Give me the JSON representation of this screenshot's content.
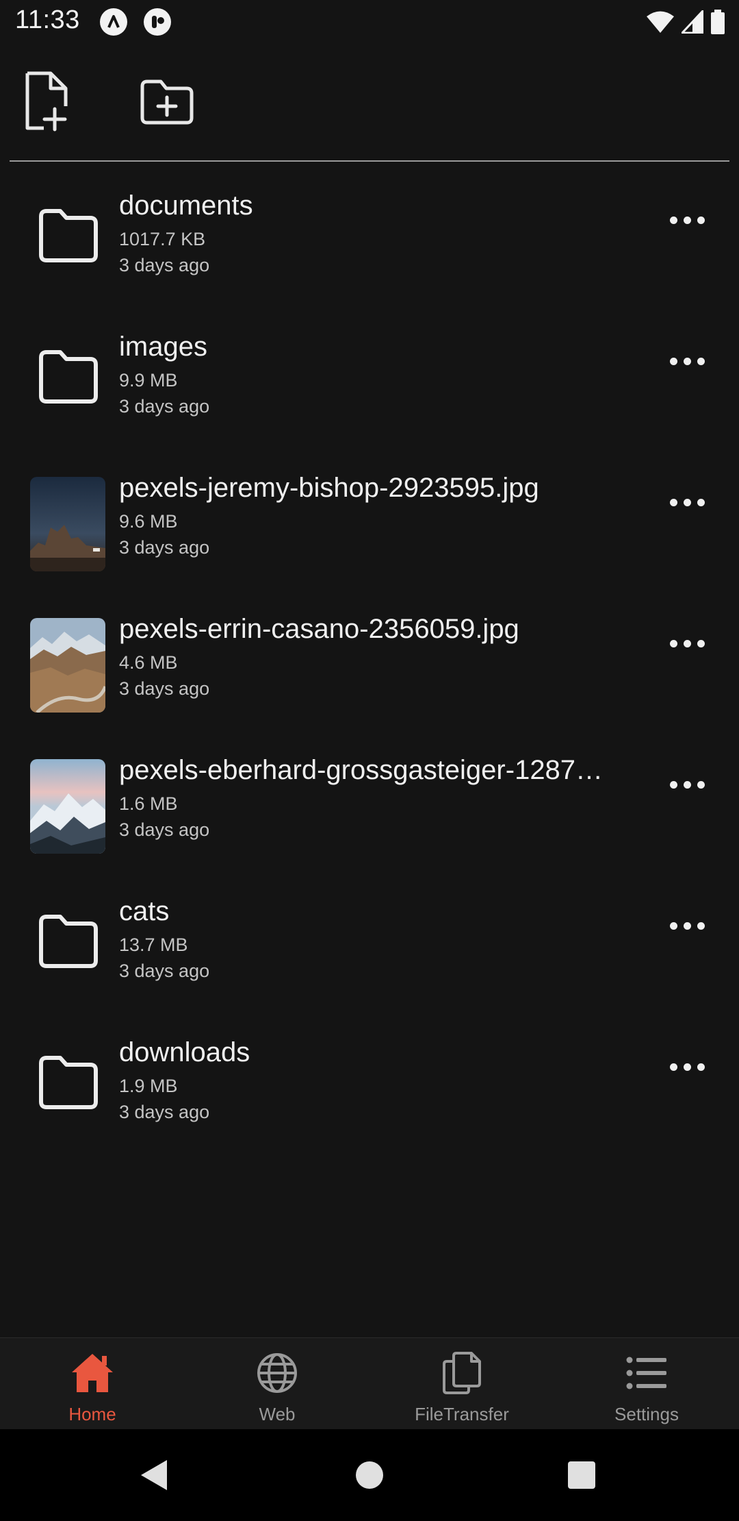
{
  "status_bar": {
    "time": "11:33",
    "icons": [
      "app-notification-icon",
      "app-notification-icon-2",
      "wifi-icon",
      "cellular-signal-icon",
      "battery-icon"
    ]
  },
  "toolbar": {
    "new_file_icon": "file-plus-icon",
    "new_folder_icon": "folder-plus-icon"
  },
  "files": [
    {
      "type": "folder",
      "name": "documents",
      "size": "1017.7 KB",
      "date": "3 days ago"
    },
    {
      "type": "folder",
      "name": "images",
      "size": "9.9 MB",
      "date": "3 days ago"
    },
    {
      "type": "image",
      "name": "pexels-jeremy-bishop-2923595.jpg",
      "size": "9.6 MB",
      "date": "3 days ago"
    },
    {
      "type": "image",
      "name": "pexels-errin-casano-2356059.jpg",
      "size": "4.6 MB",
      "date": "3 days ago"
    },
    {
      "type": "image",
      "name": "pexels-eberhard-grossgasteiger-1287…",
      "size": "1.6 MB",
      "date": "3 days ago"
    },
    {
      "type": "folder",
      "name": "cats",
      "size": "13.7 MB",
      "date": "3 days ago"
    },
    {
      "type": "folder",
      "name": "downloads",
      "size": "1.9 MB",
      "date": "3 days ago"
    }
  ],
  "bottom_nav": {
    "items": [
      {
        "label": "Home",
        "icon": "home-icon",
        "active": true
      },
      {
        "label": "Web",
        "icon": "globe-icon",
        "active": false
      },
      {
        "label": "FileTransfer",
        "icon": "copy-files-icon",
        "active": false
      },
      {
        "label": "Settings",
        "icon": "list-icon",
        "active": false
      }
    ],
    "active_color": "#e9573f",
    "inactive_color": "#9a9a9a"
  },
  "system_nav": {
    "icons": [
      "back-icon",
      "home-circle-icon",
      "recents-icon"
    ]
  }
}
